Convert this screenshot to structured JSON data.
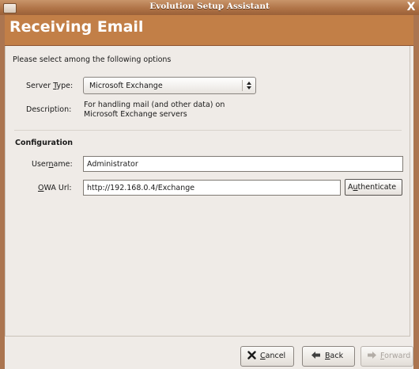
{
  "window": {
    "title": "Evolution Setup Assistant",
    "close_glyph": "X"
  },
  "header": {
    "title": "Receiving Email"
  },
  "instruction": "Please select among the following options",
  "server_type": {
    "label_pre": "Server ",
    "label_ul": "T",
    "label_post": "ype:",
    "selected": "Microsoft Exchange"
  },
  "description": {
    "label": "Description:",
    "text": "For handling mail (and other data) on Microsoft Exchange servers"
  },
  "configuration": {
    "title": "Configuration",
    "username": {
      "label_pre": "User",
      "label_ul": "n",
      "label_post": "ame:",
      "value": "Administrator"
    },
    "owa_url": {
      "label_ul": "O",
      "label_post": "WA Url:",
      "value": "http://192.168.0.4/Exchange"
    },
    "authenticate": {
      "label_pre": "A",
      "label_ul": "u",
      "label_post": "thenticate"
    }
  },
  "buttons": {
    "cancel": {
      "label_ul": "C",
      "label_post": "ancel",
      "icon": "cancel-icon",
      "color": "#1a1a1a"
    },
    "back": {
      "label_ul": "B",
      "label_post": "ack",
      "icon": "back-arrow-icon"
    },
    "forward": {
      "label_ul": "F",
      "label_post": "orward",
      "icon": "forward-arrow-icon",
      "enabled": false
    }
  },
  "colors": {
    "titlebar": "#b07448",
    "header": "#c27f47",
    "background": "#efebe7",
    "frame": "#ab7550"
  }
}
